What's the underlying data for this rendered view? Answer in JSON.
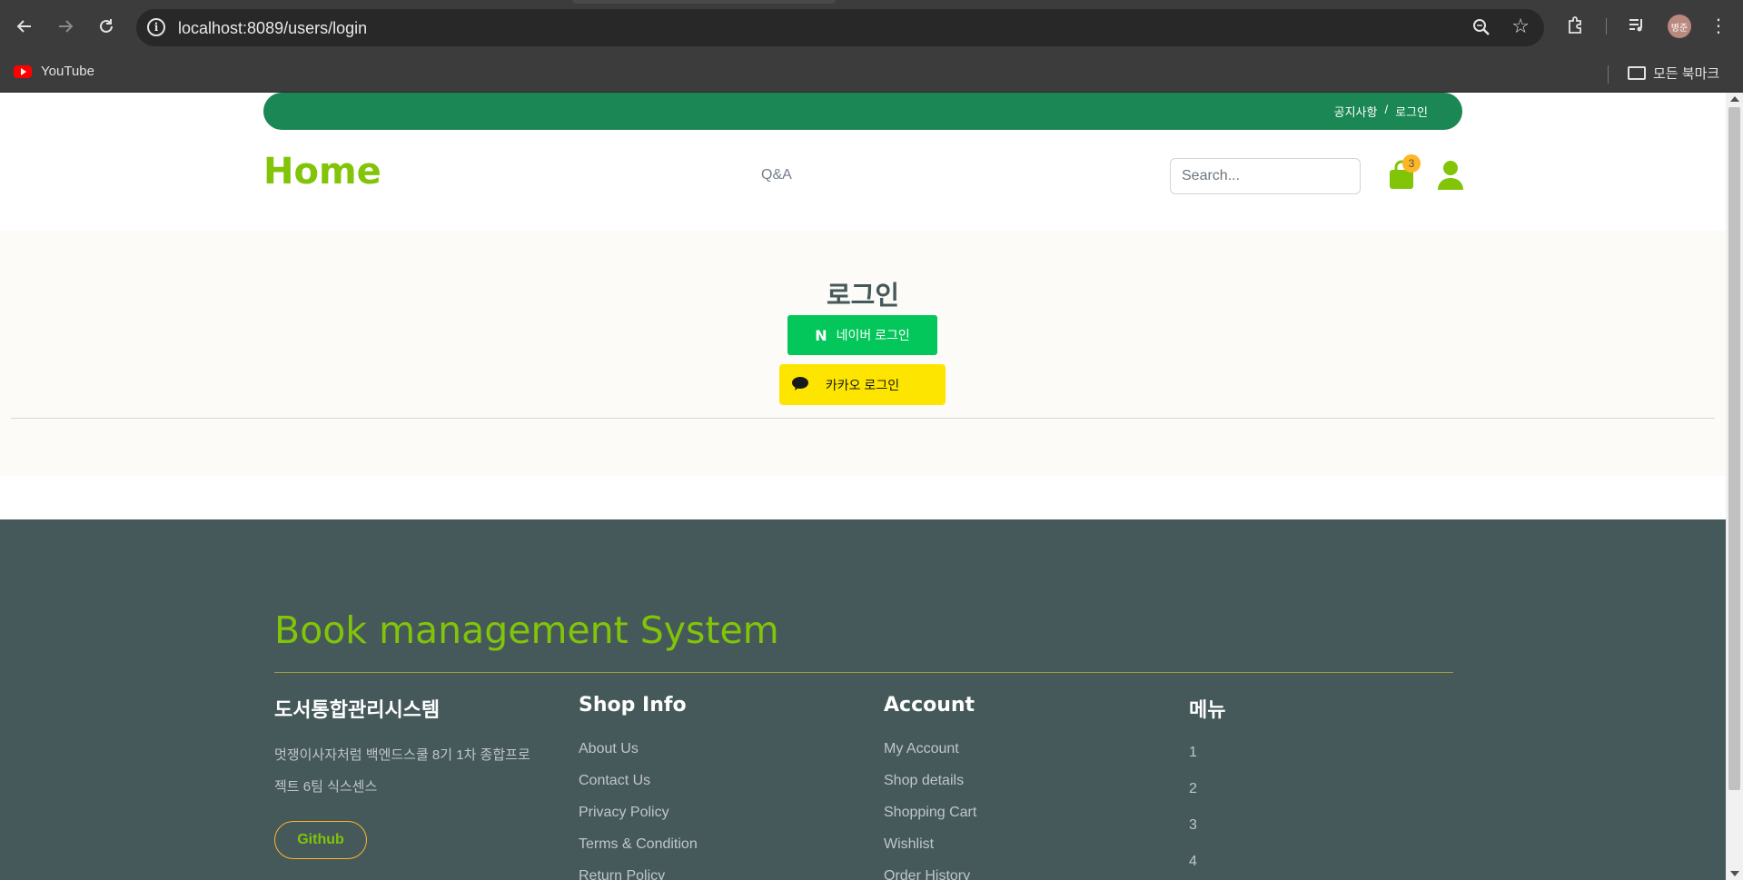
{
  "browser": {
    "url": "localhost:8089/users/login",
    "bookmarks": [
      {
        "label": "YouTube"
      }
    ],
    "all_bookmarks_label": "모든 북마크",
    "profile_initials": "병준"
  },
  "topbar": {
    "links": [
      "공지사항",
      "로그인"
    ],
    "separator": "/"
  },
  "header": {
    "logo": "Home",
    "nav": [
      "Q&A"
    ],
    "search_placeholder": "Search...",
    "cart_count": "3"
  },
  "login": {
    "title": "로그인",
    "naver_icon": "N",
    "naver_label": "네이버 로그인",
    "kakao_label": "카카오 로그인"
  },
  "footer": {
    "brand": "Book management System",
    "columns": [
      {
        "title": "도서통합관리시스템",
        "description": "멋쟁이사자처럼 백엔드스쿨 8기 1차 종합프로젝트 6팀 식스센스",
        "button": "Github"
      },
      {
        "title": "Shop Info",
        "links": [
          "About Us",
          "Contact Us",
          "Privacy Policy",
          "Terms & Condition",
          "Return Policy"
        ]
      },
      {
        "title": "Account",
        "links": [
          "My Account",
          "Shop details",
          "Shopping Cart",
          "Wishlist",
          "Order History"
        ]
      },
      {
        "title": "메뉴",
        "links": [
          "1",
          "2",
          "3",
          "4"
        ]
      }
    ]
  },
  "colors": {
    "primary_green": "#81c408",
    "topbar_green": "#1a8754",
    "footer_bg": "#45595b",
    "naver": "#03c75a",
    "kakao": "#fee500",
    "badge": "#ffb524"
  }
}
